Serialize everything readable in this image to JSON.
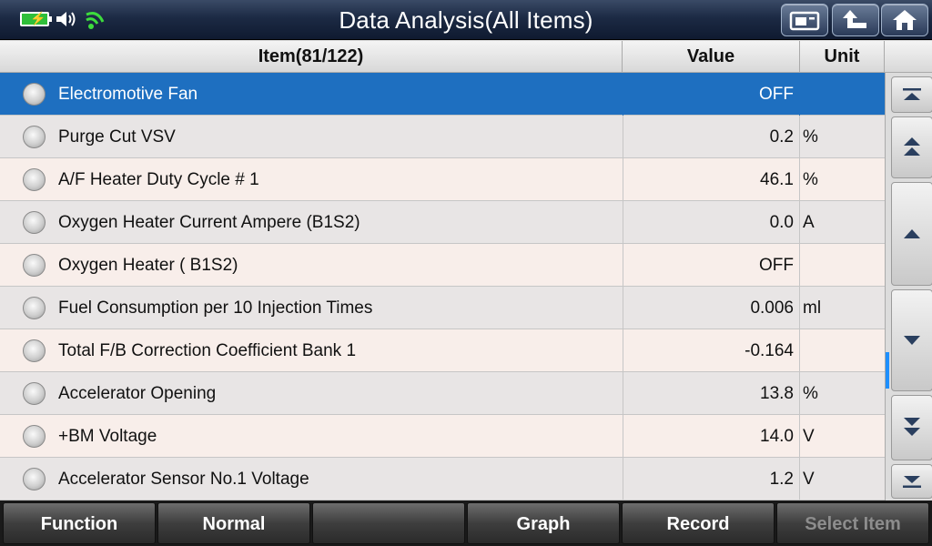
{
  "window": {
    "title": "Data Analysis(All Items)"
  },
  "status_icons": [
    "battery-icon",
    "speaker-icon",
    "wifi-icon"
  ],
  "title_buttons": [
    "screenshot-icon",
    "back-up-icon",
    "home-icon"
  ],
  "table": {
    "headers": {
      "item": "Item(81/122)",
      "value": "Value",
      "unit": "Unit"
    },
    "rows": [
      {
        "name": "Electromotive Fan",
        "value": "OFF",
        "unit": "",
        "selected": true
      },
      {
        "name": "Purge Cut VSV",
        "value": "0.2",
        "unit": "%"
      },
      {
        "name": "A/F Heater Duty Cycle # 1",
        "value": "46.1",
        "unit": "%"
      },
      {
        "name": "Oxygen Heater Current Ampere (B1S2)",
        "value": "0.0",
        "unit": "A"
      },
      {
        "name": "Oxygen Heater ( B1S2)",
        "value": "OFF",
        "unit": ""
      },
      {
        "name": "Fuel Consumption per 10 Injection Times",
        "value": "0.006",
        "unit": "ml"
      },
      {
        "name": "Total F/B Correction Coefficient Bank 1",
        "value": "-0.164",
        "unit": ""
      },
      {
        "name": "Accelerator Opening",
        "value": "13.8",
        "unit": "%"
      },
      {
        "name": "+BM Voltage",
        "value": "14.0",
        "unit": "V"
      },
      {
        "name": "Accelerator Sensor No.1 Voltage",
        "value": "1.2",
        "unit": "V"
      }
    ]
  },
  "bottom_buttons": [
    {
      "label": "Function"
    },
    {
      "label": "Normal"
    },
    {
      "label": ""
    },
    {
      "label": "Graph"
    },
    {
      "label": "Record"
    },
    {
      "label": "Select Item",
      "disabled": true
    }
  ],
  "colors": {
    "selected_row": "#1e6fc0",
    "scroll_thumb": "#1e8fff",
    "battery": "#2fbf3a",
    "wifi": "#3ddc3d"
  }
}
